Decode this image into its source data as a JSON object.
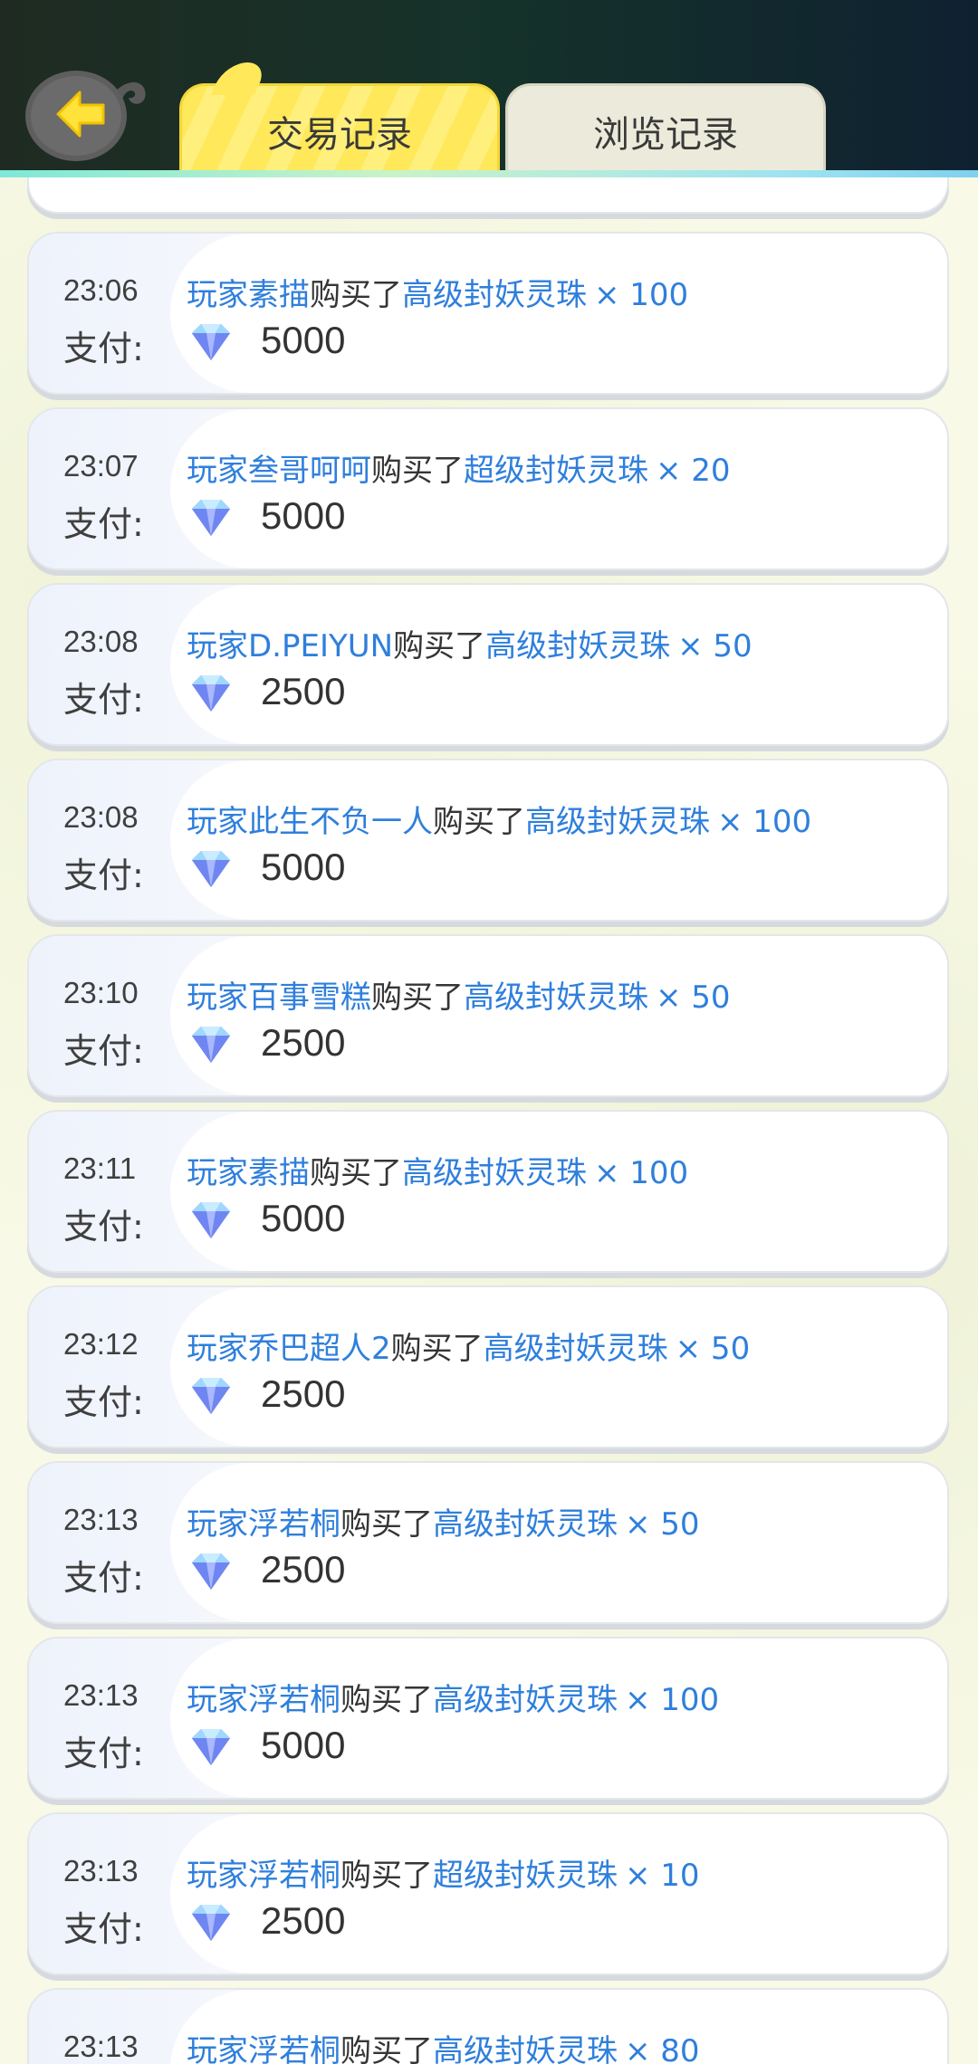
{
  "tabs": {
    "trade": "交易记录",
    "browse": "浏览记录"
  },
  "colors": {
    "accent_yellow": "#ffe85a",
    "link_blue": "#2f7fdc",
    "header_dark": "#1a2b25"
  },
  "pay_label": "支付:",
  "records": [
    {
      "time": "23:06",
      "prefix": "玩家",
      "player": "素描",
      "verb": "购买了",
      "item": "高级封妖灵珠",
      "qty": "× 100",
      "amount": "5000"
    },
    {
      "time": "23:07",
      "prefix": "玩家",
      "player": "叁哥呵呵",
      "verb": "购买了",
      "item": "超级封妖灵珠",
      "qty": "× 20",
      "amount": "5000"
    },
    {
      "time": "23:08",
      "prefix": "玩家",
      "player": "D.PEIYUN",
      "verb": "购买了",
      "item": "高级封妖灵珠",
      "qty": "× 50",
      "amount": "2500"
    },
    {
      "time": "23:08",
      "prefix": "玩家",
      "player": "此生不负一人",
      "verb": "购买了",
      "item": "高级封妖灵珠",
      "qty": "× 100",
      "amount": "5000"
    },
    {
      "time": "23:10",
      "prefix": "玩家",
      "player": "百事雪糕",
      "verb": "购买了",
      "item": "高级封妖灵珠",
      "qty": "× 50",
      "amount": "2500"
    },
    {
      "time": "23:11",
      "prefix": "玩家",
      "player": "素描",
      "verb": "购买了",
      "item": "高级封妖灵珠",
      "qty": "× 100",
      "amount": "5000"
    },
    {
      "time": "23:12",
      "prefix": "玩家",
      "player": "乔巴超人2",
      "verb": "购买了",
      "item": "高级封妖灵珠",
      "qty": "× 50",
      "amount": "2500"
    },
    {
      "time": "23:13",
      "prefix": "玩家",
      "player": "浮若桐",
      "verb": "购买了",
      "item": "高级封妖灵珠",
      "qty": "× 50",
      "amount": "2500"
    },
    {
      "time": "23:13",
      "prefix": "玩家",
      "player": "浮若桐",
      "verb": "购买了",
      "item": "高级封妖灵珠",
      "qty": "× 100",
      "amount": "5000"
    },
    {
      "time": "23:13",
      "prefix": "玩家",
      "player": "浮若桐",
      "verb": "购买了",
      "item": "超级封妖灵珠",
      "qty": "× 10",
      "amount": "2500"
    },
    {
      "time": "23:13",
      "prefix": "玩家",
      "player": "浮若桐",
      "verb": "购买了",
      "item": "高级封妖灵珠",
      "qty": "× 80",
      "amount": ""
    }
  ]
}
